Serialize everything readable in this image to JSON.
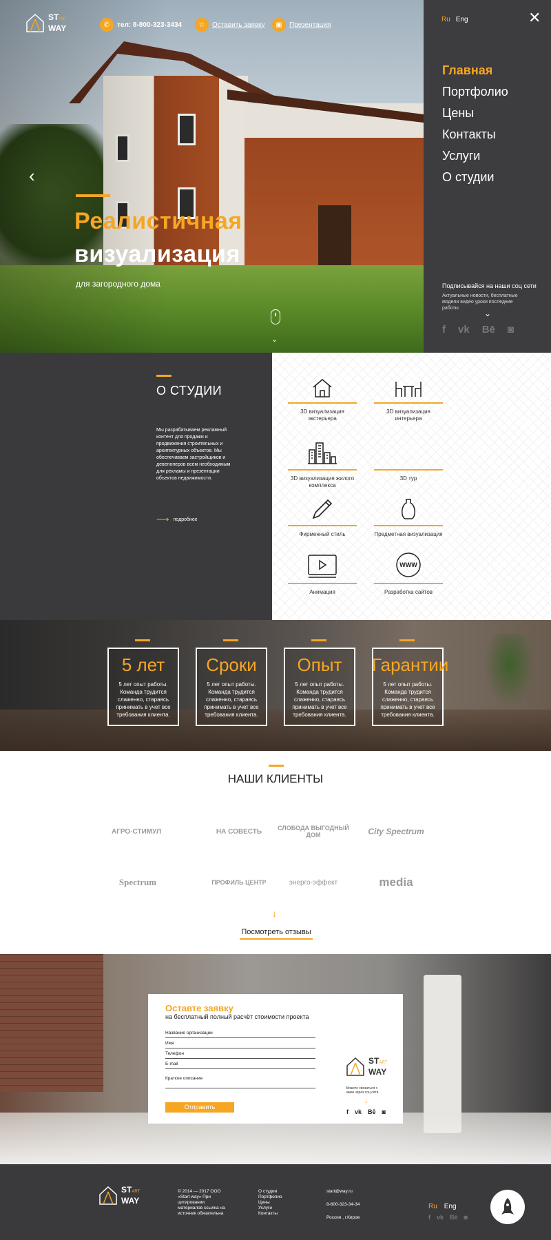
{
  "brand": {
    "st": "ST",
    "art": "ART",
    "way": "WAY"
  },
  "header": {
    "phone": "тел: 8-800-323-3434",
    "request": "Оставить заявку",
    "presentation": "Презентация"
  },
  "hero": {
    "title_line1": "Реалистичная",
    "title_line2": "визуализация",
    "subtitle": "для загородного дома"
  },
  "side_menu": {
    "lang_ru": "Ru",
    "lang_en": "Eng",
    "items": [
      "Главная",
      "Портфолио",
      "Цены",
      "Контакты",
      "Услуги",
      "О студии"
    ],
    "active_index": 0,
    "subscribe_title": "Подписывайся на наши соц сети",
    "subscribe_text": "Актуальные новости, бесплатные модели видео уроки последние работы",
    "socials": [
      "facebook-icon",
      "vk-icon",
      "behance-icon",
      "instagram-icon"
    ]
  },
  "about": {
    "title": "О СТУДИИ",
    "text": "Мы разрабатываем рекламный контент для продажи и продвижения строительных и архитектурных объектов. Мы обеспечиваем застройщиков и девелоперов всем необходимым для рекламы и презентации объектов недвижимости.",
    "more": "подробнее"
  },
  "services": [
    {
      "label": "3D визуализация экстерьера",
      "icon": "house-icon"
    },
    {
      "label": "3D визуализация интерьера",
      "icon": "table-icon"
    },
    {
      "label": "3D визуализация жилого комплекса",
      "icon": "buildings-icon"
    },
    {
      "label": "3D тур",
      "icon": ""
    },
    {
      "label": "Фирменный стиль",
      "icon": "pencil-icon"
    },
    {
      "label": "Предметная визуализация",
      "icon": "vase-icon"
    },
    {
      "label": "Анимация",
      "icon": "video-icon"
    },
    {
      "label": "Разработка сайтов",
      "icon": "www-icon"
    }
  ],
  "stats": [
    {
      "title": "5 лет",
      "text": "5 лет опыт работы. Команда трудится слаженно, стараясь принимать в учет все требования клиента."
    },
    {
      "title": "Сроки",
      "text": "5 лет опыт работы. Команда трудится слаженно, стараясь принимать в учет все требования клиента."
    },
    {
      "title": "Опыт",
      "text": "5 лет опыт работы. Команда трудится слаженно, стараясь принимать в учет все требования клиента."
    },
    {
      "title": "Гарантии",
      "text": "5 лет опыт работы. Команда трудится слаженно, стараясь принимать в учет все требования клиента."
    }
  ],
  "clients": {
    "title": "НАШИ КЛИЕНТЫ",
    "logos": [
      "АГРО·СТИМУЛ",
      "НА СОВЕСТЬ",
      "СЛОБОДА ВЫГОДНЫЙ ДОМ",
      "City Spectrum",
      "Spectrum",
      "ПРОФИЛЬ ЦЕНТР",
      "энерго-эффект",
      "media"
    ],
    "reviews_link": "Посмотреть отзывы"
  },
  "order_form": {
    "title": "Оставте заявку",
    "subtitle": "на бесплатный полный расчёт стоимости проекта",
    "fields": [
      "Название организации",
      "Имя",
      "Телефон",
      "E-mail",
      "Краткое описание"
    ],
    "submit": "Отправить",
    "social_note": "Можете связаться с нами через соц сети"
  },
  "footer": {
    "copyright": "© 2014 — 2017 ООО «Start way» При цитировании материалов ссылка на источник обязательна",
    "links": [
      "О студии",
      "Портфолио",
      "Цены",
      "Услуги",
      "Контакты"
    ],
    "email": "start@way.ru",
    "phone": "8-800-323-34-34",
    "address": "Россия , г.Киров"
  },
  "colors": {
    "accent": "#f5a623",
    "dark": "#3a3a3d"
  }
}
